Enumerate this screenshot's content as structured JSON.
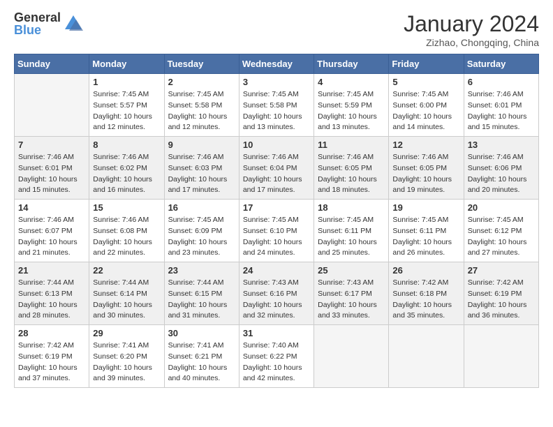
{
  "header": {
    "logo_general": "General",
    "logo_blue": "Blue",
    "month_title": "January 2024",
    "location": "Zizhao, Chongqing, China"
  },
  "weekdays": [
    "Sunday",
    "Monday",
    "Tuesday",
    "Wednesday",
    "Thursday",
    "Friday",
    "Saturday"
  ],
  "weeks": [
    [
      {
        "day": "",
        "info": ""
      },
      {
        "day": "1",
        "info": "Sunrise: 7:45 AM\nSunset: 5:57 PM\nDaylight: 10 hours\nand 12 minutes."
      },
      {
        "day": "2",
        "info": "Sunrise: 7:45 AM\nSunset: 5:58 PM\nDaylight: 10 hours\nand 12 minutes."
      },
      {
        "day": "3",
        "info": "Sunrise: 7:45 AM\nSunset: 5:58 PM\nDaylight: 10 hours\nand 13 minutes."
      },
      {
        "day": "4",
        "info": "Sunrise: 7:45 AM\nSunset: 5:59 PM\nDaylight: 10 hours\nand 13 minutes."
      },
      {
        "day": "5",
        "info": "Sunrise: 7:45 AM\nSunset: 6:00 PM\nDaylight: 10 hours\nand 14 minutes."
      },
      {
        "day": "6",
        "info": "Sunrise: 7:46 AM\nSunset: 6:01 PM\nDaylight: 10 hours\nand 15 minutes."
      }
    ],
    [
      {
        "day": "7",
        "info": "Sunrise: 7:46 AM\nSunset: 6:01 PM\nDaylight: 10 hours\nand 15 minutes."
      },
      {
        "day": "8",
        "info": "Sunrise: 7:46 AM\nSunset: 6:02 PM\nDaylight: 10 hours\nand 16 minutes."
      },
      {
        "day": "9",
        "info": "Sunrise: 7:46 AM\nSunset: 6:03 PM\nDaylight: 10 hours\nand 17 minutes."
      },
      {
        "day": "10",
        "info": "Sunrise: 7:46 AM\nSunset: 6:04 PM\nDaylight: 10 hours\nand 17 minutes."
      },
      {
        "day": "11",
        "info": "Sunrise: 7:46 AM\nSunset: 6:05 PM\nDaylight: 10 hours\nand 18 minutes."
      },
      {
        "day": "12",
        "info": "Sunrise: 7:46 AM\nSunset: 6:05 PM\nDaylight: 10 hours\nand 19 minutes."
      },
      {
        "day": "13",
        "info": "Sunrise: 7:46 AM\nSunset: 6:06 PM\nDaylight: 10 hours\nand 20 minutes."
      }
    ],
    [
      {
        "day": "14",
        "info": "Sunrise: 7:46 AM\nSunset: 6:07 PM\nDaylight: 10 hours\nand 21 minutes."
      },
      {
        "day": "15",
        "info": "Sunrise: 7:46 AM\nSunset: 6:08 PM\nDaylight: 10 hours\nand 22 minutes."
      },
      {
        "day": "16",
        "info": "Sunrise: 7:45 AM\nSunset: 6:09 PM\nDaylight: 10 hours\nand 23 minutes."
      },
      {
        "day": "17",
        "info": "Sunrise: 7:45 AM\nSunset: 6:10 PM\nDaylight: 10 hours\nand 24 minutes."
      },
      {
        "day": "18",
        "info": "Sunrise: 7:45 AM\nSunset: 6:11 PM\nDaylight: 10 hours\nand 25 minutes."
      },
      {
        "day": "19",
        "info": "Sunrise: 7:45 AM\nSunset: 6:11 PM\nDaylight: 10 hours\nand 26 minutes."
      },
      {
        "day": "20",
        "info": "Sunrise: 7:45 AM\nSunset: 6:12 PM\nDaylight: 10 hours\nand 27 minutes."
      }
    ],
    [
      {
        "day": "21",
        "info": "Sunrise: 7:44 AM\nSunset: 6:13 PM\nDaylight: 10 hours\nand 28 minutes."
      },
      {
        "day": "22",
        "info": "Sunrise: 7:44 AM\nSunset: 6:14 PM\nDaylight: 10 hours\nand 30 minutes."
      },
      {
        "day": "23",
        "info": "Sunrise: 7:44 AM\nSunset: 6:15 PM\nDaylight: 10 hours\nand 31 minutes."
      },
      {
        "day": "24",
        "info": "Sunrise: 7:43 AM\nSunset: 6:16 PM\nDaylight: 10 hours\nand 32 minutes."
      },
      {
        "day": "25",
        "info": "Sunrise: 7:43 AM\nSunset: 6:17 PM\nDaylight: 10 hours\nand 33 minutes."
      },
      {
        "day": "26",
        "info": "Sunrise: 7:42 AM\nSunset: 6:18 PM\nDaylight: 10 hours\nand 35 minutes."
      },
      {
        "day": "27",
        "info": "Sunrise: 7:42 AM\nSunset: 6:19 PM\nDaylight: 10 hours\nand 36 minutes."
      }
    ],
    [
      {
        "day": "28",
        "info": "Sunrise: 7:42 AM\nSunset: 6:19 PM\nDaylight: 10 hours\nand 37 minutes."
      },
      {
        "day": "29",
        "info": "Sunrise: 7:41 AM\nSunset: 6:20 PM\nDaylight: 10 hours\nand 39 minutes."
      },
      {
        "day": "30",
        "info": "Sunrise: 7:41 AM\nSunset: 6:21 PM\nDaylight: 10 hours\nand 40 minutes."
      },
      {
        "day": "31",
        "info": "Sunrise: 7:40 AM\nSunset: 6:22 PM\nDaylight: 10 hours\nand 42 minutes."
      },
      {
        "day": "",
        "info": ""
      },
      {
        "day": "",
        "info": ""
      },
      {
        "day": "",
        "info": ""
      }
    ]
  ]
}
